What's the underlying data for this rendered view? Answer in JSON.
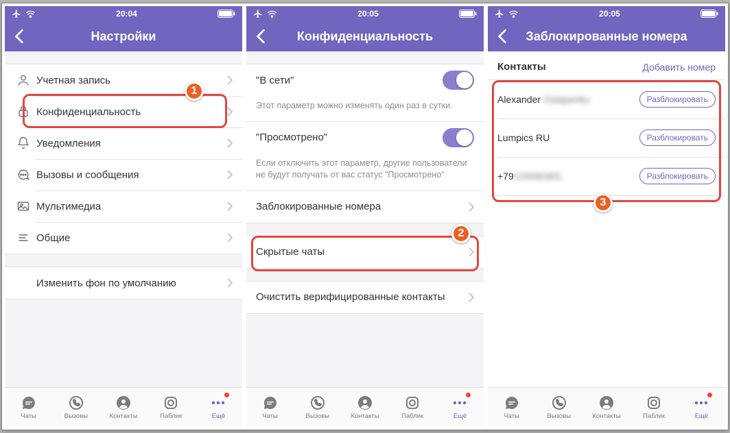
{
  "statusbar": {
    "time1": "20:04",
    "time2": "20:05",
    "time3": "20:05"
  },
  "screens": {
    "settings": {
      "title": "Настройки",
      "items": {
        "account": "Учетная запись",
        "privacy": "Конфиденциальность",
        "notifications": "Уведомления",
        "calls": "Вызовы и сообщения",
        "media": "Мультимедиа",
        "general": "Общие",
        "wallpaper": "Изменить фон по умолчанию"
      }
    },
    "privacy": {
      "title": "Конфиденциальность",
      "online_label": "\"В сети\"",
      "online_desc": "Этот параметр можно изменять один раз в сутки.",
      "seen_label": "\"Просмотрено\"",
      "seen_desc": "Если отключить этот параметр, другие пользователи не будут получать от вас статус \"Просмотрено\"",
      "blocked": "Заблокированные номера",
      "hidden": "Скрытые чаты",
      "clear": "Очистить верифицированные контакты"
    },
    "blocked": {
      "title": "Заблокированные номера",
      "section": "Контакты",
      "add": "Добавить номер",
      "unblock": "Разблокировать",
      "contacts": [
        {
          "name": "Alexander",
          "hidden": "Ostapenko"
        },
        {
          "name": "Lumpics RU",
          "hidden": ""
        },
        {
          "name": "+79",
          "hidden": "120090401"
        }
      ]
    }
  },
  "tabs": {
    "chats": "Чаты",
    "calls": "Вызовы",
    "contacts": "Контакты",
    "public": "Паблик",
    "more": "Ещё"
  },
  "badges": {
    "b1": "1",
    "b2": "2",
    "b3": "3"
  }
}
